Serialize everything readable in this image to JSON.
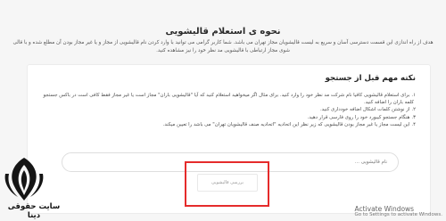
{
  "header": {
    "title": "نحوه ی استعلام قالیشویی",
    "intro": "هدف از راه اندازی این قسمت دسترسی آسان و سریع به لیست قالیشویان مجاز تهران می باشد. شما کاربر گرامی می توانید با وارد کردن نام قالیشویی از مجاز و یا غیر مجاز بودن آن مطلع شده و با قالی شوی مجاز ارتباطی با قالیشویی مد نظر خود را نیز مشاهده کنید."
  },
  "tips_card": {
    "title": "نکته مهم قبل از جستجو",
    "items": [
      {
        "num": "۱.",
        "text": "برای استعلام قالیشویی کافیا نام شرکت مد نظر خود را وارد کنید. برای مثال اگر میخواهید استعلام کنید که آیا \"قالیشویی باران\" مجاز است یا غیر مجاز فقط کافی است در باکس جستجو"
      },
      {
        "num": "",
        "text": "کلمه باران را اضافه کنید."
      },
      {
        "num": "۲.",
        "text": "از نوشتن کلمات اشکال اضافه خودداری کنید."
      },
      {
        "num": "۳.",
        "text": "هنگام جستجو کیبورد خود را روی فارسی قرار دهید."
      },
      {
        "num": "۴.",
        "text": "این لیست مجاز یا غیر مجاز بودن قالیشویی که زیر نظر این اتحادیه \"اتحادیه صنف قالیشویان تهران\" می باشد را تعیین میکند."
      }
    ]
  },
  "search": {
    "placeholder": "نام قالیشویی ..."
  },
  "search_button": {
    "label": "بررسی قالیشویی"
  },
  "brand": {
    "name": "سایت حقوقی دینا"
  },
  "watermark": {
    "line1": "Activate Windows",
    "line2": "Go to Settings to activate Windows."
  },
  "colors": {
    "highlight": "#e52b2b",
    "background": "#f6f6f6",
    "card": "#ffffff"
  }
}
